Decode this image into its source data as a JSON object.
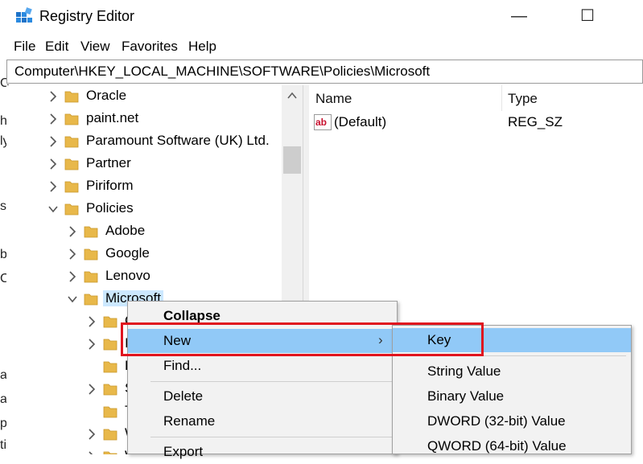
{
  "window": {
    "title": "Registry Editor",
    "minimize_glyph": "—",
    "maximize_glyph": "☐",
    "close_glyph": "✕"
  },
  "menubar": [
    "File",
    "Edit",
    "View",
    "Favorites",
    "Help"
  ],
  "address": "Computer\\HKEY_LOCAL_MACHINE\\SOFTWARE\\Policies\\Microsoft",
  "tree": [
    {
      "label": "Oracle",
      "state": "collapsed"
    },
    {
      "label": "paint.net",
      "state": "collapsed"
    },
    {
      "label": "Paramount Software (UK) Ltd.",
      "state": "collapsed"
    },
    {
      "label": "Partner",
      "state": "collapsed"
    },
    {
      "label": "Piriform",
      "state": "collapsed"
    },
    {
      "label": "Policies",
      "state": "expanded"
    },
    {
      "label": "Adobe",
      "state": "collapsed"
    },
    {
      "label": "Google",
      "state": "collapsed"
    },
    {
      "label": "Lenovo",
      "state": "collapsed"
    },
    {
      "label": "Microsoft",
      "state": "expanded",
      "selected": true
    },
    {
      "label": "C",
      "state": "collapsed"
    },
    {
      "label": "I",
      "state": "collapsed"
    },
    {
      "label": "P",
      "state": "none"
    },
    {
      "label": "S",
      "state": "collapsed"
    },
    {
      "label": "T",
      "state": "none"
    },
    {
      "label": "W",
      "state": "collapsed"
    },
    {
      "label": "W",
      "state": "collapsed"
    }
  ],
  "list": {
    "columns": [
      "Name",
      "Type"
    ],
    "rows": [
      {
        "name": "(Default)",
        "type": "REG_SZ",
        "icon": "string-value-icon"
      }
    ]
  },
  "context_menu": {
    "items": [
      "Collapse",
      "New",
      "Find...",
      "Delete",
      "Rename",
      "Export"
    ],
    "submenu_arrow": "›"
  },
  "submenu": {
    "items": [
      "Key",
      "String Value",
      "Binary Value",
      "DWORD (32-bit) Value",
      "QWORD (64-bit) Value"
    ]
  },
  "background_window_chars": [
    "C",
    "h",
    "ly",
    "s",
    "b",
    "C",
    "a",
    "a",
    "p",
    "ti"
  ],
  "colors": {
    "highlight": "#91c9f7",
    "selection": "#cce8ff",
    "annotation_red": "#e0141e",
    "folder": "#e8b84a"
  }
}
